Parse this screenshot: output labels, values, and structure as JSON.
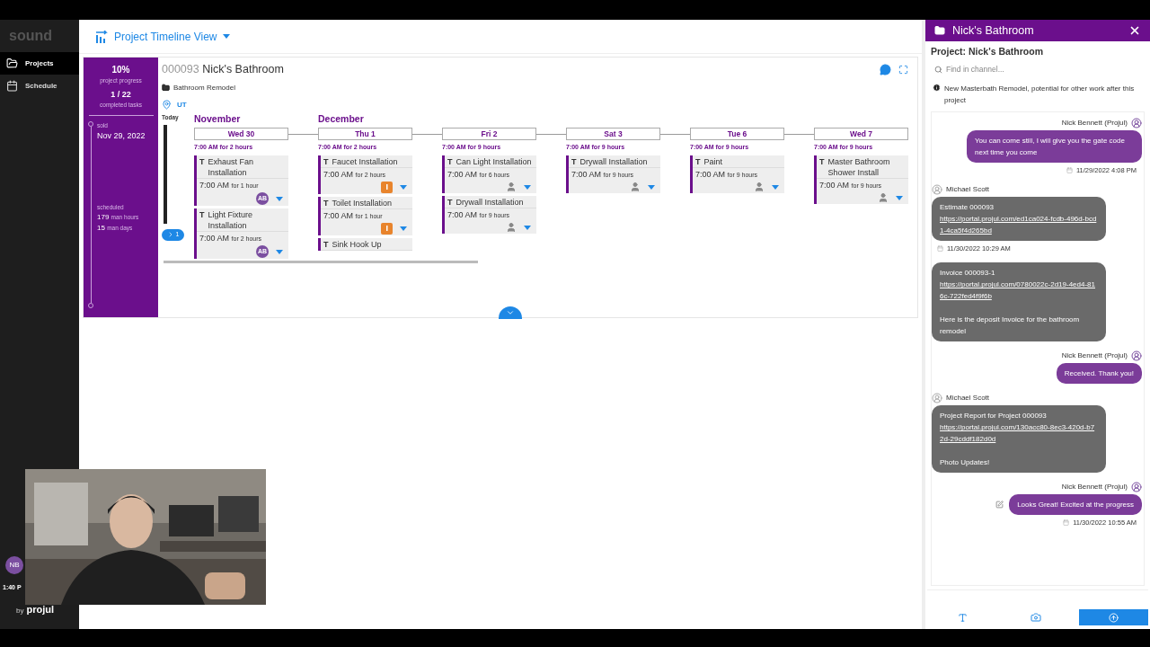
{
  "sidebar": {
    "logo": "sound",
    "items": [
      {
        "label": "Projects",
        "selected": true
      },
      {
        "label": "Schedule",
        "selected": false
      }
    ],
    "user_initials": "NB",
    "time": "1:40 P",
    "footer_by": "by",
    "footer_brand": "projul"
  },
  "header": {
    "title": "Project Timeline View"
  },
  "project": {
    "progress": "10%",
    "progress_label": "project progress",
    "tasks": "1 / 22",
    "tasks_label": "completed tasks",
    "sold_label": "sold",
    "sold_date": "Nov 29, 2022",
    "scheduled_label": "scheduled",
    "man_hours": "179",
    "man_hours_label": "man hours",
    "man_days": "15",
    "man_days_label": "man days",
    "number": "000093",
    "name": "Nick's Bathroom",
    "type": "Bathroom Remodel",
    "location": "UT",
    "today_label": "Today",
    "overflow_count": "1"
  },
  "days": [
    {
      "month": "November",
      "label": "Wed 30",
      "summary": "7:00 AM for 2 hours",
      "tasks": [
        {
          "marker": "T",
          "title": "Exhaust Fan Installation",
          "time": "7:00 AM",
          "duration": "for 1 hour",
          "assignee": {
            "kind": "initials",
            "text": "AB"
          }
        },
        {
          "marker": "T",
          "title": "Light Fixture Installation",
          "time": "7:00 AM",
          "duration": "for 2 hours",
          "assignee": {
            "kind": "initials",
            "text": "AB"
          }
        }
      ]
    },
    {
      "month": "December",
      "label": "Thu 1",
      "summary": "7:00 AM for 2 hours",
      "tasks": [
        {
          "marker": "T",
          "title": "Faucet Installation",
          "time": "7:00 AM",
          "duration": "for 2 hours",
          "assignee": {
            "kind": "flag"
          }
        },
        {
          "marker": "T",
          "title": "Toilet Installation",
          "time": "7:00 AM",
          "duration": "for 1 hour",
          "assignee": {
            "kind": "flag"
          }
        },
        {
          "marker": "T",
          "title": "Sink Hook Up"
        }
      ]
    },
    {
      "label": "Fri 2",
      "summary": "7:00 AM for 9 hours",
      "tasks": [
        {
          "marker": "T",
          "title": "Can Light Installation",
          "time": "7:00 AM",
          "duration": "for 6 hours",
          "assignee": {
            "kind": "person"
          }
        },
        {
          "marker": "T",
          "title": "Drywall Installation",
          "time": "7:00 AM",
          "duration": "for 9 hours",
          "assignee": {
            "kind": "person"
          }
        }
      ]
    },
    {
      "label": "Sat 3",
      "summary": "7:00 AM for 9 hours",
      "tasks": [
        {
          "marker": "T",
          "title": "Drywall Installation",
          "time": "7:00 AM",
          "duration": "for 9 hours",
          "assignee": {
            "kind": "person"
          }
        }
      ]
    },
    {
      "label": "Tue 6",
      "summary": "7:00 AM for 9 hours",
      "tasks": [
        {
          "marker": "T",
          "title": "Paint",
          "time": "7:00 AM",
          "duration": "for 9 hours",
          "assignee": {
            "kind": "person"
          }
        }
      ]
    },
    {
      "label": "Wed 7",
      "summary": "7:00 AM for 9 hours",
      "tasks": [
        {
          "marker": "T",
          "title": "Master Bathroom Shower Install",
          "time": "7:00 AM",
          "duration": "for 9 hours",
          "assignee": {
            "kind": "person"
          }
        }
      ]
    }
  ],
  "chat": {
    "title": "Nick's Bathroom",
    "project_title": "Project: Nick's Bathroom",
    "search": {
      "placeholder": "Find in channel..."
    },
    "note": "New Masterbath Remodel, potential for other work after this project",
    "messages": [
      {
        "kind": "outgoing",
        "author": "Nick Bennett (Projul)",
        "lines": [
          {
            "kind": "text",
            "text": "You can come still, I will give you the gate code next time you come"
          }
        ],
        "time": "11/29/2022 4:08 PM"
      },
      {
        "kind": "incoming",
        "author": "Michael Scott",
        "lines": [
          {
            "kind": "text",
            "text": "Estimate 000093"
          },
          {
            "kind": "link",
            "text": "https://portal.projul.com/ed1ca024-fcdb-496d-bcd1-4ca5f4d265bd"
          }
        ],
        "time": "11/30/2022 10:29 AM"
      },
      {
        "kind": "incoming",
        "lines": [
          {
            "kind": "text",
            "text": "Invoice 000093-1"
          },
          {
            "kind": "link",
            "text": "https://portal.projul.com/0780022c-2d19-4ed4-816c-722fed4f9f6b"
          },
          {
            "kind": "gap"
          },
          {
            "kind": "text",
            "text": "Here is the deposit Invoice for the bathroom remodel"
          }
        ]
      },
      {
        "kind": "outgoing",
        "author": "Nick Bennett (Projul)",
        "lines": [
          {
            "kind": "text",
            "text": "Received. Thank you!"
          }
        ]
      },
      {
        "kind": "incoming",
        "author": "Michael Scott",
        "lines": [
          {
            "kind": "text",
            "text": "Project Report for Project 000093"
          },
          {
            "kind": "link",
            "text": "https://portal.projul.com/130acc80-8ec3-420d-b72d-29cddf182d0d"
          },
          {
            "kind": "gap"
          },
          {
            "kind": "text",
            "text": "Photo Updates!"
          }
        ]
      },
      {
        "kind": "outgoing",
        "author": "Nick Bennett (Projul)",
        "editable": true,
        "lines": [
          {
            "kind": "text",
            "text": "Looks Great! Excited at the progress"
          }
        ],
        "time": "11/30/2022 10:55 AM"
      }
    ]
  }
}
